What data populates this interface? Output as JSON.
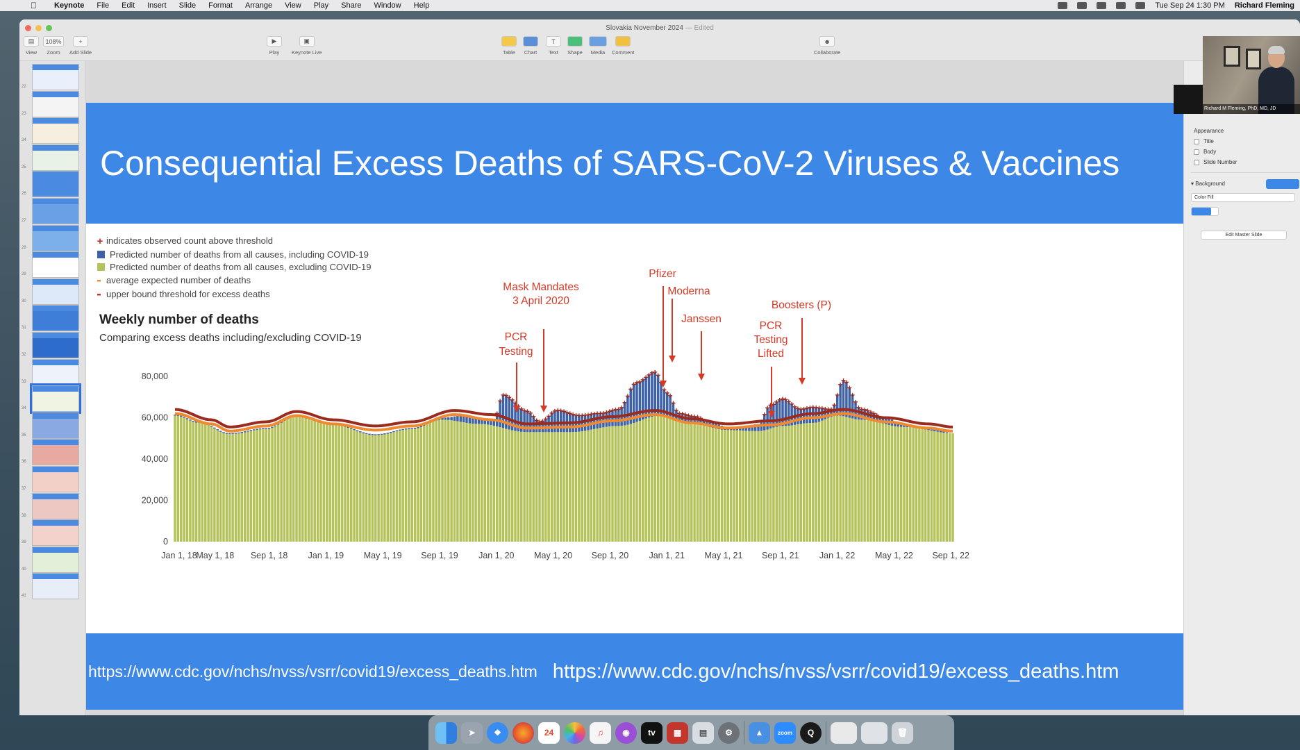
{
  "menubar": {
    "app_name": "Keynote",
    "items": [
      "File",
      "Edit",
      "Insert",
      "Slide",
      "Format",
      "Arrange",
      "View",
      "Play",
      "Share",
      "Window",
      "Help"
    ],
    "clock": "Tue Sep 24  1:30 PM",
    "user": "Richard Fleming"
  },
  "window": {
    "doc_title": "Slovakia November 2024",
    "doc_status": "— Edited",
    "toolbar": {
      "view": "View",
      "zoom": "Zoom",
      "zoom_value": "108%",
      "add_slide": "Add Slide",
      "play": "Play",
      "keynote_live": "Keynote Live",
      "table": "Table",
      "chart": "Chart",
      "text": "Text",
      "shape": "Shape",
      "media": "Media",
      "comment": "Comment",
      "collaborate": "Collaborate"
    }
  },
  "navigator": {
    "slide_numbers": [
      "22",
      "23",
      "24",
      "25",
      "26",
      "27",
      "28",
      "29",
      "30",
      "31",
      "32",
      "33",
      "34",
      "35",
      "36",
      "37",
      "38",
      "39",
      "40",
      "41"
    ],
    "selected_index": 12
  },
  "slide": {
    "title": "Consequential Excess Deaths of SARS-CoV-2 Viruses & Vaccines",
    "footer_url_1": "https://www.cdc.gov/nchs/nvss/vsrr/covid19/excess_deaths.htm",
    "footer_url_2": "https://www.cdc.gov/nchs/nvss/vsrr/covid19/excess_deaths.htm"
  },
  "chart_data": {
    "type": "bar",
    "title": "Weekly number of deaths",
    "subtitle": "Comparing excess deaths including/excluding COVID-19",
    "legend": [
      {
        "symbol": "+",
        "color": "#b83a2e",
        "label": "indicates observed count above threshold"
      },
      {
        "symbol": "square",
        "color": "#3d62a8",
        "label": "Predicted number of deaths from all causes, including COVID-19"
      },
      {
        "symbol": "square",
        "color": "#b5c25a",
        "label": "Predicted number of deaths from all causes, excluding COVID-19"
      },
      {
        "symbol": "-",
        "color": "#f08a30",
        "label": "average expected number of deaths"
      },
      {
        "symbol": "-",
        "color": "#b83a2e",
        "label": "upper bound threshold for excess deaths"
      }
    ],
    "y_ticks": [
      "0",
      "20,000",
      "40,000",
      "60,000",
      "80,000"
    ],
    "ylim": [
      0,
      85000
    ],
    "x_ticks": [
      "Jan 1, 18",
      "May 1, 18",
      "Sep 1, 18",
      "Jan 1, 19",
      "May 1, 19",
      "Sep 1, 19",
      "Jan 1, 20",
      "May 1, 20",
      "Sep 1, 20",
      "Jan 1, 21",
      "May 1, 21",
      "Sep 1, 21",
      "Jan 1, 22",
      "May 1, 22",
      "Sep 1, 22"
    ],
    "colors": {
      "excl": "#b5c25a",
      "incl": "#3d62a8",
      "expected": "#f08a30",
      "threshold": "#9b2a1f",
      "annotation": "#d43a26"
    },
    "series": [
      {
        "name": "Predicted number of deaths from all causes, including COVID-19",
        "anchor_x": [
          0,
          8,
          18,
          30,
          40,
          52,
          66,
          78,
          88,
          95,
          105,
          108,
          116,
          120,
          126,
          133,
          140,
          146,
          152,
          158,
          162,
          166,
          171,
          176,
          182,
          186,
          192,
          196,
          200,
          206,
          210,
          216,
          220,
          226,
          234,
          240,
          248,
          256
        ],
        "anchor_y": [
          61500,
          58000,
          52500,
          55000,
          61000,
          57000,
          52000,
          55000,
          60000,
          61000,
          59000,
          71000,
          63000,
          58000,
          63500,
          61000,
          62000,
          64000,
          77000,
          82000,
          72000,
          62000,
          60500,
          58000,
          55500,
          55000,
          57000,
          66000,
          69000,
          64000,
          65000,
          64000,
          78000,
          64000,
          60000,
          56500,
          55500,
          52500
        ]
      },
      {
        "name": "Predicted number of deaths from all causes, excluding COVID-19",
        "anchor_x": [
          0,
          8,
          18,
          30,
          40,
          52,
          66,
          78,
          88,
          100,
          116,
          130,
          146,
          160,
          170,
          182,
          192,
          200,
          210,
          218,
          226,
          240,
          256
        ],
        "anchor_y": [
          61000,
          57500,
          52000,
          54500,
          60500,
          56500,
          51500,
          54500,
          59000,
          57000,
          53000,
          53000,
          56000,
          61000,
          57000,
          54000,
          53500,
          56000,
          57500,
          61000,
          59000,
          55500,
          52500
        ]
      },
      {
        "name": "average expected number of deaths",
        "anchor_x": [
          0,
          12,
          18,
          30,
          40,
          52,
          66,
          78,
          92,
          104,
          116,
          130,
          144,
          158,
          170,
          182,
          196,
          210,
          220,
          234,
          248,
          256
        ],
        "anchor_y": [
          62000,
          57000,
          53500,
          56000,
          61000,
          57000,
          54000,
          56000,
          61500,
          59000,
          55000,
          55500,
          58500,
          61500,
          57500,
          55000,
          56500,
          60000,
          62000,
          58000,
          55000,
          53500
        ]
      },
      {
        "name": "upper bound threshold for excess deaths",
        "anchor_x": [
          0,
          12,
          18,
          30,
          40,
          52,
          66,
          78,
          92,
          104,
          116,
          130,
          144,
          158,
          170,
          182,
          196,
          210,
          220,
          234,
          248,
          256
        ],
        "anchor_y": [
          64000,
          59000,
          55500,
          58000,
          63000,
          59000,
          56000,
          58000,
          63500,
          61500,
          57000,
          57500,
          60500,
          63500,
          59500,
          57000,
          58500,
          62000,
          64000,
          60000,
          57000,
          55500
        ]
      }
    ],
    "annotations": [
      {
        "text": "PCR Testing",
        "x_week": 113
      },
      {
        "text": "Mask Mandates 3 April 2020",
        "x_week": 121
      },
      {
        "text": "Pfizer",
        "x_week": 160
      },
      {
        "text": "Moderna",
        "x_week": 163
      },
      {
        "text": "Janssen",
        "x_week": 173
      },
      {
        "text": "PCR Testing Lifted",
        "x_week": 196
      },
      {
        "text": "Boosters (P)",
        "x_week": 206
      }
    ]
  },
  "inspector": {
    "appearance": "Appearance",
    "title": "Title",
    "body": "Body",
    "slide_number": "Slide Number",
    "background": "Background",
    "color_fill": "Color Fill",
    "edit_master": "Edit Master Slide",
    "accent": "#3d88e6"
  },
  "webcam": {
    "name": "Richard M Fleming, PhD, MD, JD"
  }
}
